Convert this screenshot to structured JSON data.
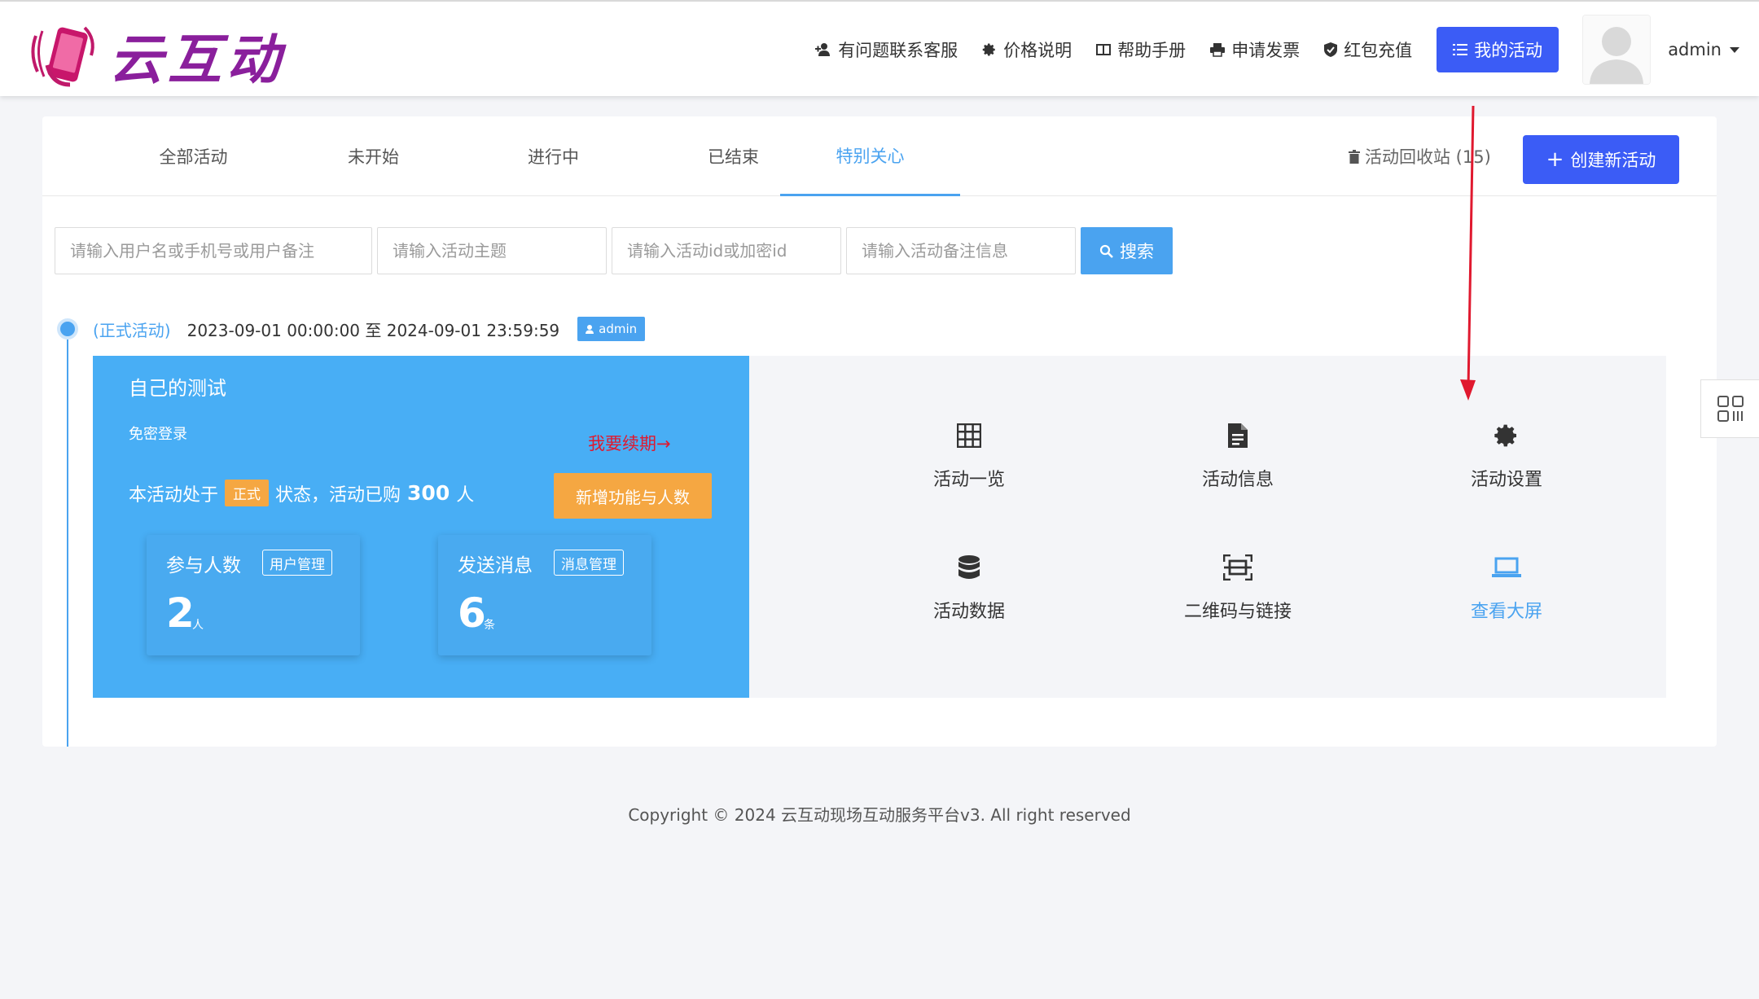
{
  "header": {
    "logo_text": "云互动",
    "nav": [
      {
        "icon": "user-plus-icon",
        "label": "有问题联系客服"
      },
      {
        "icon": "gear-icon",
        "label": "价格说明"
      },
      {
        "icon": "book-icon",
        "label": "帮助手册"
      },
      {
        "icon": "printer-icon",
        "label": "申请发票"
      },
      {
        "icon": "shield-check-icon",
        "label": "红包充值"
      }
    ],
    "my_activity_label": "我的活动",
    "user_name": "admin"
  },
  "tabs": [
    {
      "label": "全部活动",
      "active": false
    },
    {
      "label": "未开始",
      "active": false
    },
    {
      "label": "进行中",
      "active": false
    },
    {
      "label": "已结束",
      "active": false
    },
    {
      "label": "特别关心",
      "active": true
    }
  ],
  "recycle_label": "活动回收站 (15)",
  "create_label": "创建新活动",
  "search": {
    "placeholders": [
      "请输入用户名或手机号或用户备注",
      "请输入活动主题",
      "请输入活动id或加密id",
      "请输入活动备注信息"
    ],
    "button_label": "搜索"
  },
  "event": {
    "type_label": "(正式活动)",
    "time_range": "2023-09-01 00:00:00 至 2024-09-01 23:59:59",
    "owner": "admin",
    "title": "自己的测试",
    "login_mode": "免密登录",
    "renew_label": "我要续期→",
    "status_prefix": "本活动处于",
    "status_badge": "正式",
    "status_mid": "状态，活动已购",
    "purchased": "300",
    "purchased_unit": "人",
    "add_button": "新增功能与人数",
    "stats": [
      {
        "label": "参与人数",
        "manage": "用户管理",
        "value": "2",
        "unit": "人"
      },
      {
        "label": "发送消息",
        "manage": "消息管理",
        "value": "6",
        "unit": "条"
      }
    ]
  },
  "functions": [
    {
      "icon": "grid-icon",
      "label": "活动一览"
    },
    {
      "icon": "document-icon",
      "label": "活动信息"
    },
    {
      "icon": "gear-icon",
      "label": "活动设置"
    },
    {
      "icon": "database-icon",
      "label": "活动数据"
    },
    {
      "icon": "qrcode-scan-icon",
      "label": "二维码与链接"
    },
    {
      "icon": "laptop-icon",
      "label": "查看大屏"
    }
  ],
  "colors": {
    "primary": "#3b5cf6",
    "accent_blue": "#4aa3f0",
    "panel_blue": "#48aef5",
    "orange": "#f5a742",
    "red": "#e0192f"
  },
  "footer": "Copyright © 2024 云互动现场互动服务平台v3. All right reserved"
}
